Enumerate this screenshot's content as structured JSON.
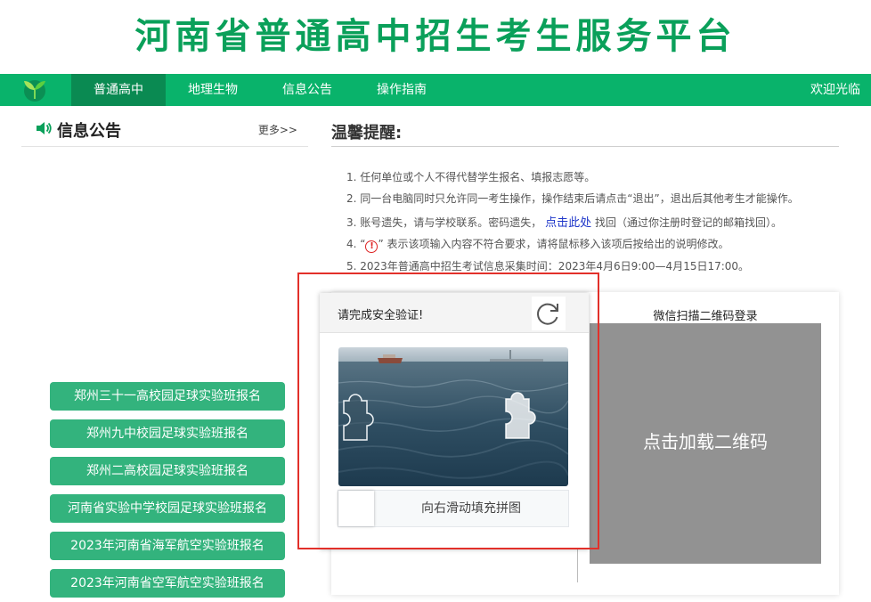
{
  "site": {
    "title": "河南省普通高中招生考生服务平台"
  },
  "nav": {
    "items": [
      {
        "label": "普通高中",
        "active": true
      },
      {
        "label": "地理生物",
        "active": false
      },
      {
        "label": "信息公告",
        "active": false
      },
      {
        "label": "操作指南",
        "active": false
      }
    ],
    "welcome": "欢迎光临"
  },
  "notice": {
    "title": "信息公告",
    "more": "更多>>",
    "buttons": [
      "郑州三十一高校园足球实验班报名",
      "郑州九中校园足球实验班报名",
      "郑州二高校园足球实验班报名",
      "河南省实验中学校园足球实验班报名",
      "2023年河南省海军航空实验班报名",
      "2023年河南省空军航空实验班报名"
    ]
  },
  "tips": {
    "title": "温馨提醒:",
    "items": [
      "1. 任何单位或个人不得代替学生报名、填报志愿等。",
      "2. 同一台电脑同时只允许同一考生操作，操作结束后请点击“退出”，退出后其他考生才能操作。",
      {
        "before": "3. 账号遗失，请与学校联系。密码遗失，",
        "link": "点击此处",
        "after": " 找回（通过你注册时登记的邮箱找回）。"
      },
      {
        "before": "4. “",
        "icon_text": "!",
        "after": "” 表示该项输入内容不符合要求，请将鼠标移入该项后按给出的说明修改。"
      },
      "5. 2023年普通高中招生考试信息采集时间：2023年4月6日9:00—4月15日17:00。"
    ]
  },
  "qr": {
    "title": "微信扫描二维码登录",
    "load_text": "点击加载二维码"
  },
  "captcha": {
    "title": "请完成安全验证!",
    "slider_text": "向右滑动填充拼图",
    "slider_progress": 0
  },
  "colors": {
    "brand_green": "#0aa05a",
    "nav_green": "#09b36b",
    "button_green": "#33b37d",
    "highlight_red": "#e2302a",
    "link_blue": "#1d35c9"
  },
  "icons": {
    "logo": "sprout-logo-icon",
    "speaker": "speaker-icon",
    "refresh": "refresh-icon",
    "warning": "warning-circle-icon",
    "puzzle": "puzzle-piece-icon"
  }
}
